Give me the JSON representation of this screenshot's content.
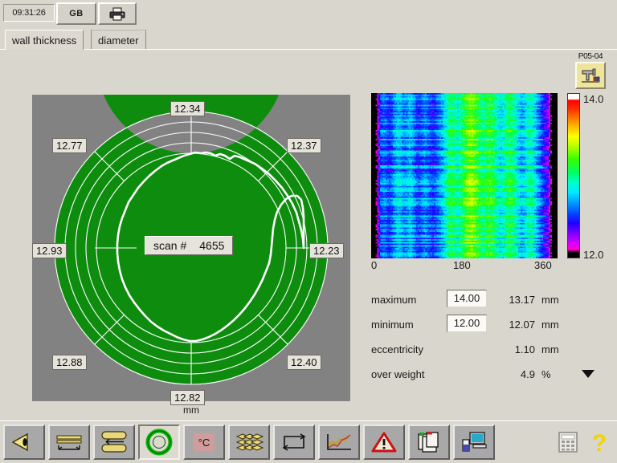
{
  "header": {
    "clock": "09:31:26",
    "language_button": "GB",
    "print_icon": "printer-icon"
  },
  "tabs": [
    {
      "label": "wall thickness",
      "active": true
    },
    {
      "label": "diameter",
      "active": false
    }
  ],
  "station": {
    "label": "P05-04",
    "icon": "extruder-machine-icon"
  },
  "polar_chart": {
    "unit_label": "mm",
    "scan_label": "scan #",
    "scan_value": "4655",
    "ring_color": "#0e8c0e",
    "background_color": "#828282",
    "grid_color": "#ffffff",
    "trace_color": "#ffffff",
    "sector_values": [
      {
        "label": "12.34",
        "angle_deg": 90
      },
      {
        "label": "12.37",
        "angle_deg": 45
      },
      {
        "label": "12.23",
        "angle_deg": 0
      },
      {
        "label": "12.40",
        "angle_deg": -45
      },
      {
        "label": "12.82",
        "angle_deg": -90
      },
      {
        "label": "12.88",
        "angle_deg": -135
      },
      {
        "label": "12.93",
        "angle_deg": 180
      },
      {
        "label": "12.77",
        "angle_deg": 135
      }
    ]
  },
  "chart_data": {
    "type": "heatmap",
    "title": "",
    "xlabel": "",
    "ylabel": "",
    "x_ticks": [
      "0",
      "180",
      "360"
    ],
    "xlim": [
      0,
      360
    ],
    "colorbar": {
      "max": "14.0",
      "min": "12.0",
      "unit": "mm"
    },
    "description": "wall thickness unrolled over circumference vs scan time",
    "columns": 64,
    "rows": 96,
    "profile": [
      12.25,
      12.3,
      12.42,
      12.55,
      12.62,
      12.58,
      12.5,
      12.6,
      12.72,
      12.8,
      12.74,
      12.66,
      12.7,
      12.78,
      12.7,
      12.58,
      12.52,
      12.6,
      12.68,
      12.62,
      12.55,
      12.5,
      12.58,
      12.66,
      12.74,
      12.86,
      12.98,
      13.06,
      13.02,
      12.94,
      12.98,
      13.08,
      13.18,
      13.26,
      13.3,
      13.24,
      13.14,
      13.06,
      13.02,
      13.08,
      13.14,
      13.1,
      13.0,
      12.9,
      12.84,
      12.92,
      13.02,
      13.08,
      13.02,
      12.92,
      12.82,
      12.74,
      12.8,
      12.9,
      12.96,
      12.88,
      12.76,
      12.64,
      12.52,
      12.42,
      12.34,
      12.22,
      12.12,
      12.06
    ]
  },
  "readouts": [
    {
      "name": "maximum",
      "field": "14.00",
      "value": "13.17",
      "unit": "mm",
      "has_field": true,
      "has_caret": false
    },
    {
      "name": "minimum",
      "field": "12.00",
      "value": "12.07",
      "unit": "mm",
      "has_field": true,
      "has_caret": false
    },
    {
      "name": "eccentricity",
      "field": "",
      "value": "1.10",
      "unit": "mm",
      "has_field": false,
      "has_caret": false
    },
    {
      "name": "over weight",
      "field": "",
      "value": "4.9",
      "unit": "%",
      "has_field": false,
      "has_caret": true
    }
  ],
  "toolbar": {
    "items": [
      {
        "name": "back-arrow-icon",
        "selected": false
      },
      {
        "name": "wall-thickness-line-icon",
        "selected": false
      },
      {
        "name": "diameter-ovality-icon",
        "selected": false
      },
      {
        "name": "ring-profile-icon",
        "selected": true
      },
      {
        "name": "temperature-icon",
        "selected": false
      },
      {
        "name": "layers-icon",
        "selected": false
      },
      {
        "name": "length-loop-icon",
        "selected": false
      },
      {
        "name": "trend-chart-icon",
        "selected": false
      },
      {
        "name": "alarm-warning-icon",
        "selected": false
      },
      {
        "name": "copy-pages-icon",
        "selected": false
      },
      {
        "name": "workstation-pc-icon",
        "selected": false
      }
    ],
    "right_items": [
      {
        "name": "calculator-icon"
      },
      {
        "name": "help-question-icon"
      }
    ]
  },
  "colors": {
    "window_bg": "#d9d6cd",
    "panel_gray": "#828282",
    "ring_green": "#0e8c0e",
    "accent_yellow": "#f0d000",
    "toolbar_btn": "#a8a8a8"
  }
}
